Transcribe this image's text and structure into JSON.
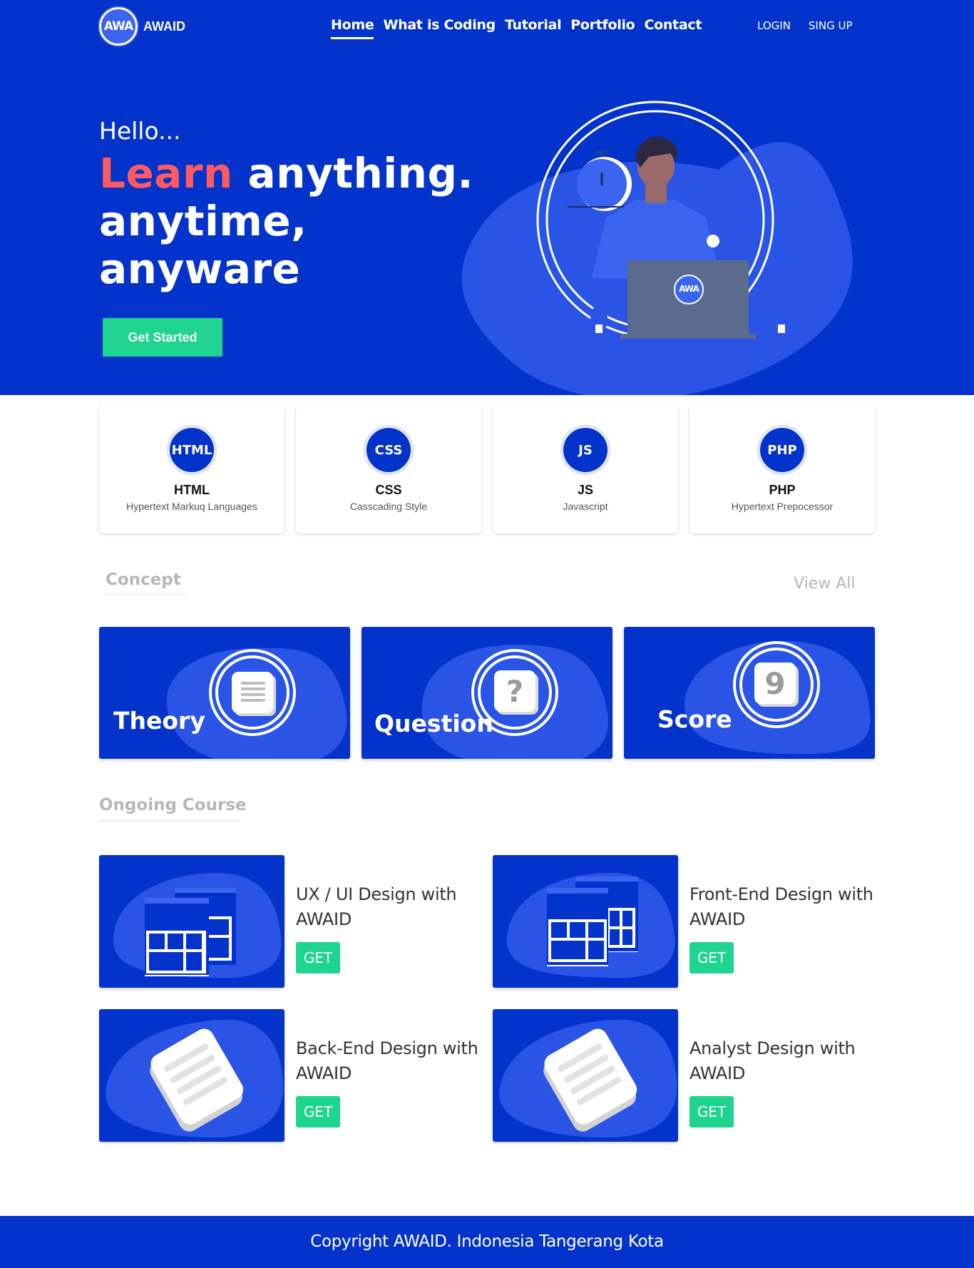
{
  "brand": {
    "logo_mark": "AWA",
    "name": "AWAID"
  },
  "nav": {
    "items": [
      {
        "label": "Home",
        "active": true
      },
      {
        "label": "What is Coding",
        "active": false
      },
      {
        "label": "Tutorial",
        "active": false
      },
      {
        "label": "Portfolio",
        "active": false
      },
      {
        "label": "Contact",
        "active": false
      }
    ],
    "login": "LOGIN",
    "signup": "SING UP"
  },
  "hero": {
    "greeting": "Hello...",
    "accent": "Learn",
    "line1_rest": "anything.",
    "line2": "anytime,",
    "line3": "anyware",
    "cta": "Get Started",
    "laptop_mark": "AWA"
  },
  "languages": [
    {
      "badge": "HTML",
      "name": "HTML",
      "desc": "Hypertext Markuq Languages"
    },
    {
      "badge": "CSS",
      "name": "CSS",
      "desc": "Casscading Style"
    },
    {
      "badge": "JS",
      "name": "JS",
      "desc": "Javascript"
    },
    {
      "badge": "PHP",
      "name": "PHP",
      "desc": "Hypertext Prepocessor"
    }
  ],
  "concept": {
    "title": "Concept",
    "view_all": "View All",
    "cards": [
      {
        "label": "Theory",
        "icon": "document-list-icon"
      },
      {
        "label": "Question",
        "icon": "question-mark-icon",
        "glyph": "?"
      },
      {
        "label": "Score",
        "icon": "number-tile-icon",
        "glyph": "9"
      }
    ]
  },
  "ongoing": {
    "title": "Ongoing Course",
    "courses": [
      {
        "title": "UX / UI Design with AWAID",
        "button": "GET",
        "icon": "window-layout-icon"
      },
      {
        "title": "Front-End Design with AWAID",
        "button": "GET",
        "icon": "window-layout-icon"
      },
      {
        "title": "Back-End Design with AWAID",
        "button": "GET",
        "icon": "paper-stack-icon"
      },
      {
        "title": "Analyst Design with AWAID",
        "button": "GET",
        "icon": "paper-stack-icon"
      }
    ]
  },
  "footer": {
    "text": "Copyright AWAID. Indonesia Tangerang Kota"
  },
  "colors": {
    "primary": "#0433cc",
    "blob": "#2a54e6",
    "accent_red": "#ff5a5f",
    "cta_green": "#1ed48f",
    "muted": "#b7b7b7"
  }
}
